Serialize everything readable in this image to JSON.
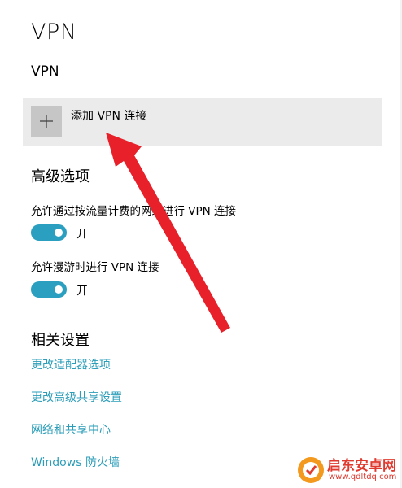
{
  "page": {
    "title": "VPN"
  },
  "vpn_section": {
    "heading": "VPN",
    "add_button_label": "添加 VPN 连接",
    "add_icon": "plus-icon"
  },
  "advanced": {
    "heading": "高级选项",
    "options": [
      {
        "label": "允许通过按流量计费的网络进行 VPN 连接",
        "state": "开",
        "on": true
      },
      {
        "label": "允许漫游时进行 VPN 连接",
        "state": "开",
        "on": true
      }
    ]
  },
  "related": {
    "heading": "相关设置",
    "links": [
      "更改适配器选项",
      "更改高级共享设置",
      "网络和共享中心",
      "Windows 防火墙"
    ]
  },
  "colors": {
    "accent": "#2a9fbf",
    "link": "#2b9db8",
    "arrow": "#e8202a",
    "row_bg": "#ebebeb"
  },
  "watermark": {
    "text": "启东安卓网",
    "url": "www.qdltdq.com"
  }
}
